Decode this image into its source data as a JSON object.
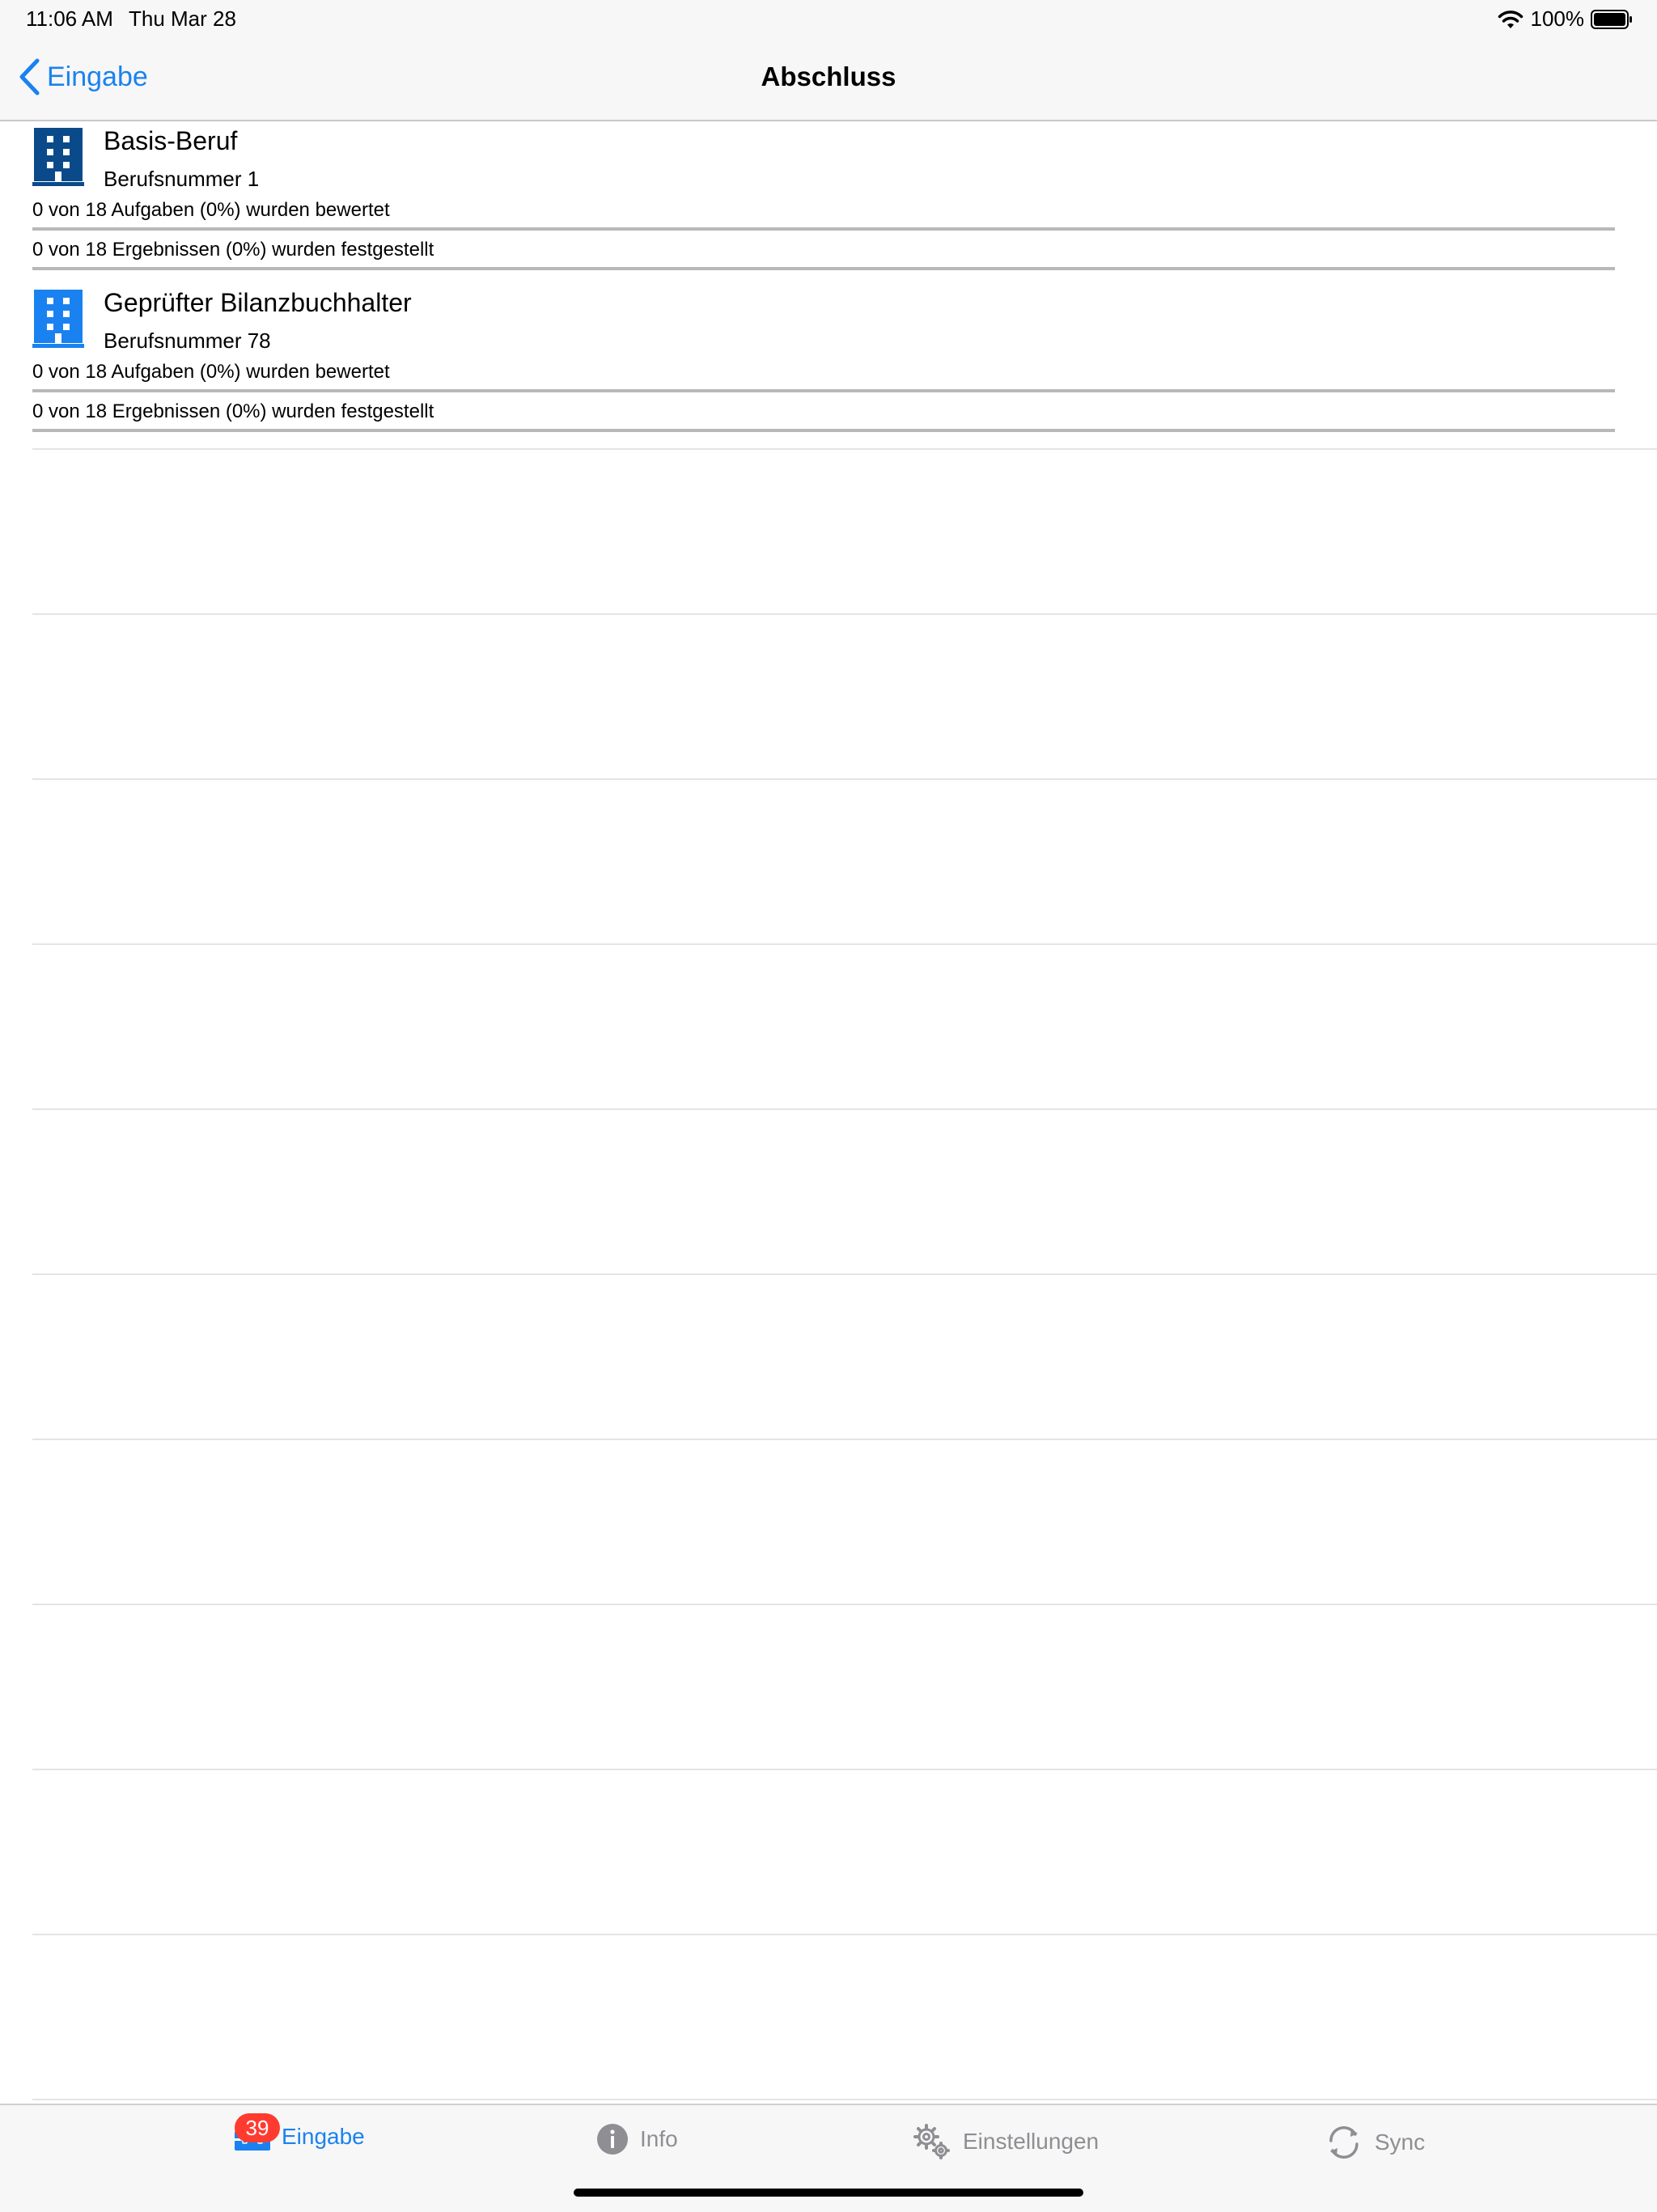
{
  "status_bar": {
    "time": "11:06 AM",
    "date": "Thu Mar 28",
    "battery": "100%"
  },
  "nav": {
    "back_label": "Eingabe",
    "title": "Abschluss"
  },
  "jobs": [
    {
      "title": "Basis-Beruf",
      "subtitle": "Berufsnummer 1",
      "tasks_text": "0 von 18 Aufgaben (0%) wurden bewertet",
      "tasks_progress": 0,
      "results_text": "0 von 18 Ergebnissen (0%) wurden festgestellt",
      "results_progress": 0,
      "icon": "building-icon",
      "icon_color": "#0a4a8a"
    },
    {
      "title": "Geprüfter Bilanzbuchhalter",
      "subtitle": "Berufsnummer 78",
      "tasks_text": "0 von 18 Aufgaben (0%) wurden bewertet",
      "tasks_progress": 0,
      "results_text": "0 von 18 Ergebnissen (0%) wurden festgestellt",
      "results_progress": 0,
      "icon": "building-icon",
      "icon_color": "#1a82f0"
    }
  ],
  "tab_bar": {
    "tabs": [
      {
        "label": "Eingabe",
        "icon": "toolbox-icon",
        "active": true,
        "badge": "39"
      },
      {
        "label": "Info",
        "icon": "info-icon",
        "active": false
      },
      {
        "label": "Einstellungen",
        "icon": "gears-icon",
        "active": false
      },
      {
        "label": "Sync",
        "icon": "sync-icon",
        "active": false
      }
    ]
  },
  "colors": {
    "accent": "#1a82f0",
    "badge": "#ff3b30",
    "inactive": "#8e8e93"
  }
}
